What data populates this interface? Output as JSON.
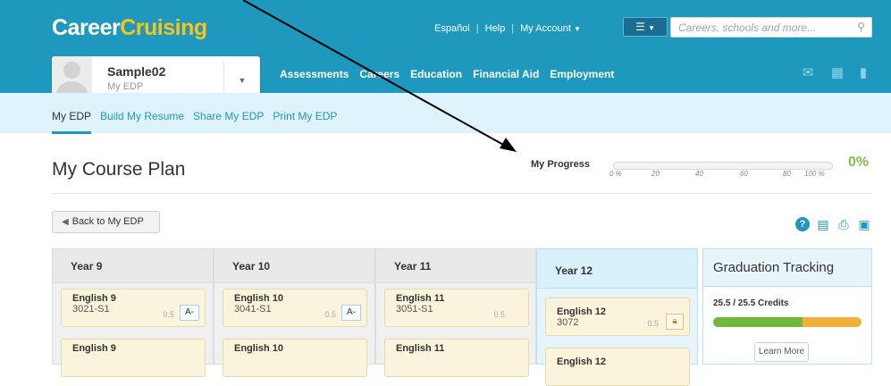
{
  "brand": {
    "part1": "Career",
    "part2": "Cruising"
  },
  "header": {
    "links": [
      "Español",
      "Help",
      "My Account"
    ],
    "search_placeholder": "Careers, schools and more..."
  },
  "user": {
    "name": "Sample02",
    "subtitle": "My EDP"
  },
  "main_nav": [
    "Assessments",
    "Careers",
    "Education",
    "Financial Aid",
    "Employment"
  ],
  "sub_nav": [
    "My EDP",
    "Build My Resume",
    "Share My EDP",
    "Print My EDP"
  ],
  "page": {
    "title": "My Course Plan",
    "back_label": "Back to My EDP"
  },
  "progress": {
    "label": "My Progress",
    "value_percent": 0,
    "value_text": "0%",
    "ticks": [
      "0 %",
      "20",
      "40",
      "60",
      "80",
      "100 %"
    ]
  },
  "years": [
    {
      "label": "Year 9",
      "courses": [
        {
          "name": "English 9",
          "code": "3021-S1",
          "credits": "0.5",
          "grade": "A-"
        },
        {
          "name": "English 9",
          "code": "",
          "credits": "",
          "grade": ""
        }
      ]
    },
    {
      "label": "Year 10",
      "courses": [
        {
          "name": "English 10",
          "code": "3041-S1",
          "credits": "0.5",
          "grade": "A-"
        },
        {
          "name": "English 10",
          "code": "",
          "credits": "",
          "grade": ""
        }
      ]
    },
    {
      "label": "Year 11",
      "courses": [
        {
          "name": "English 11",
          "code": "3051-S1",
          "credits": "0.5",
          "grade": ""
        },
        {
          "name": "English 11",
          "code": "",
          "credits": "",
          "grade": ""
        }
      ]
    },
    {
      "label": "Year 12",
      "courses": [
        {
          "name": "English 12",
          "code": "3072",
          "credits": "0.5",
          "grade": ""
        },
        {
          "name": "English 12",
          "code": "",
          "credits": "",
          "grade": ""
        }
      ]
    }
  ],
  "graduation": {
    "title": "Graduation Tracking",
    "credits_text": "25.5 / 25.5 Credits",
    "completed_fraction": 0.6,
    "learn_more": "Learn More"
  },
  "colors": {
    "brand_blue": "#1e98bd",
    "brand_yellow": "#f9c31b",
    "progress_green": "#7fc241",
    "pending_orange": "#f2b136"
  }
}
